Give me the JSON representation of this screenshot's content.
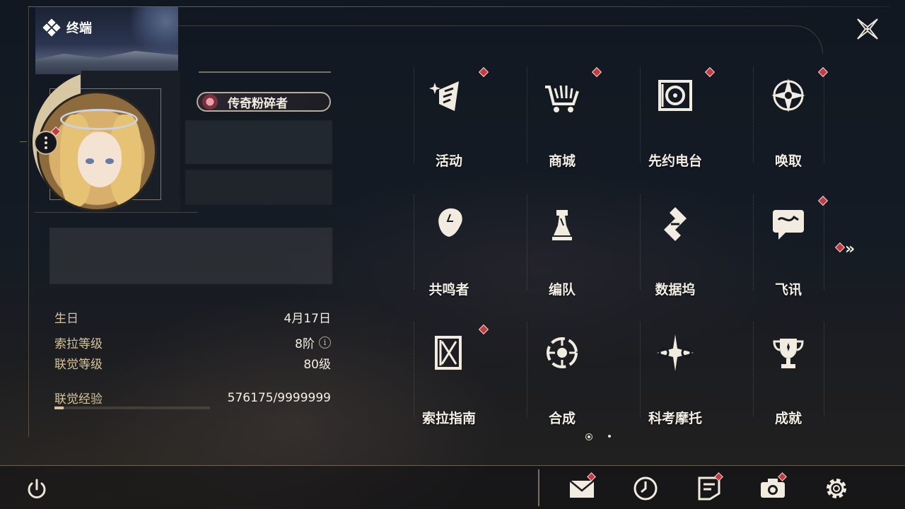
{
  "header": {
    "title": "终端"
  },
  "profile": {
    "title_badge": "传奇粉碎者",
    "stats": [
      {
        "label": "生日",
        "value": "4月17日"
      },
      {
        "label": "索拉等级",
        "value": "8阶"
      },
      {
        "label": "联觉等级",
        "value": "80级"
      },
      {
        "label": "联觉经验",
        "value": "576175/9999999"
      }
    ],
    "experience_fraction": 0.058
  },
  "menu": {
    "items": [
      {
        "label": "活动",
        "icon": "sparkle-flag-icon",
        "badge": true
      },
      {
        "label": "商城",
        "icon": "shopping-cart-icon",
        "badge": true
      },
      {
        "label": "先约电台",
        "icon": "radio-turntable-icon",
        "badge": true
      },
      {
        "label": "唤取",
        "icon": "compass-star-icon",
        "badge": true
      },
      {
        "label": "共鸣者",
        "icon": "character-profile-icon",
        "badge": false
      },
      {
        "label": "编队",
        "icon": "chess-piece-icon",
        "badge": false
      },
      {
        "label": "数据坞",
        "icon": "data-dock-icon",
        "badge": false
      },
      {
        "label": "飞讯",
        "icon": "message-chat-icon",
        "badge": true
      },
      {
        "label": "索拉指南",
        "icon": "guide-book-icon",
        "badge": true
      },
      {
        "label": "合成",
        "icon": "synthesis-icon",
        "badge": false
      },
      {
        "label": "科考摩托",
        "icon": "motorcycle-icon",
        "badge": false
      },
      {
        "label": "成就",
        "icon": "trophy-icon",
        "badge": false
      }
    ],
    "page": {
      "current": 1,
      "total": 2
    }
  },
  "bottom_bar": [
    {
      "name": "mail",
      "icon": "mail-icon",
      "badge": true
    },
    {
      "name": "history",
      "icon": "clock-icon",
      "badge": false
    },
    {
      "name": "notes",
      "icon": "note-icon",
      "badge": true
    },
    {
      "name": "camera",
      "icon": "camera-icon",
      "badge": true
    },
    {
      "name": "settings",
      "icon": "gear-icon",
      "badge": false
    }
  ],
  "colors": {
    "accent": "#d6c39a",
    "badge": "#c23b3f",
    "text": "#f4efe6"
  }
}
